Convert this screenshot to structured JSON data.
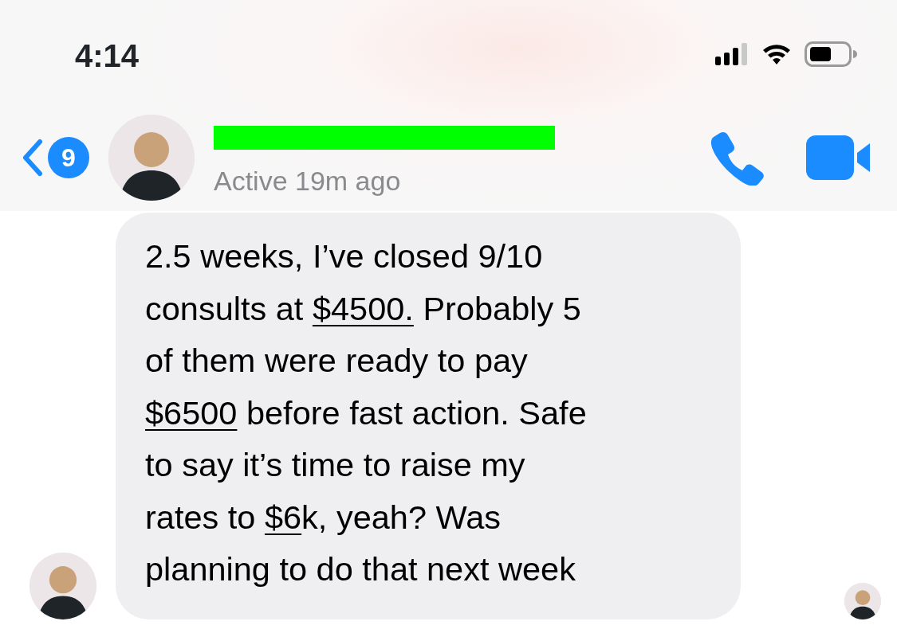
{
  "status_bar": {
    "time": "4:14"
  },
  "header": {
    "unread_count": "9",
    "name_redacted": true,
    "presence": "Active 19m ago"
  },
  "message": {
    "lines": [
      [
        {
          "kind": "text",
          "text": "2.5 weeks, I’ve closed 9/10"
        }
      ],
      [
        {
          "kind": "text",
          "text": "consults at "
        },
        {
          "kind": "link",
          "text": "$4500."
        },
        {
          "kind": "text",
          "text": " Probably 5"
        }
      ],
      [
        {
          "kind": "text",
          "text": "of them were ready to pay"
        }
      ],
      [
        {
          "kind": "link",
          "text": "$6500"
        },
        {
          "kind": "text",
          "text": " before fast action. Safe"
        }
      ],
      [
        {
          "kind": "text",
          "text": "to say it’s time to raise my"
        }
      ],
      [
        {
          "kind": "text",
          "text": "rates to "
        },
        {
          "kind": "link",
          "text": "$6"
        },
        {
          "kind": "text",
          "text": "k, yeah? Was"
        }
      ],
      [
        {
          "kind": "text",
          "text": "planning to do that next week"
        }
      ]
    ]
  }
}
